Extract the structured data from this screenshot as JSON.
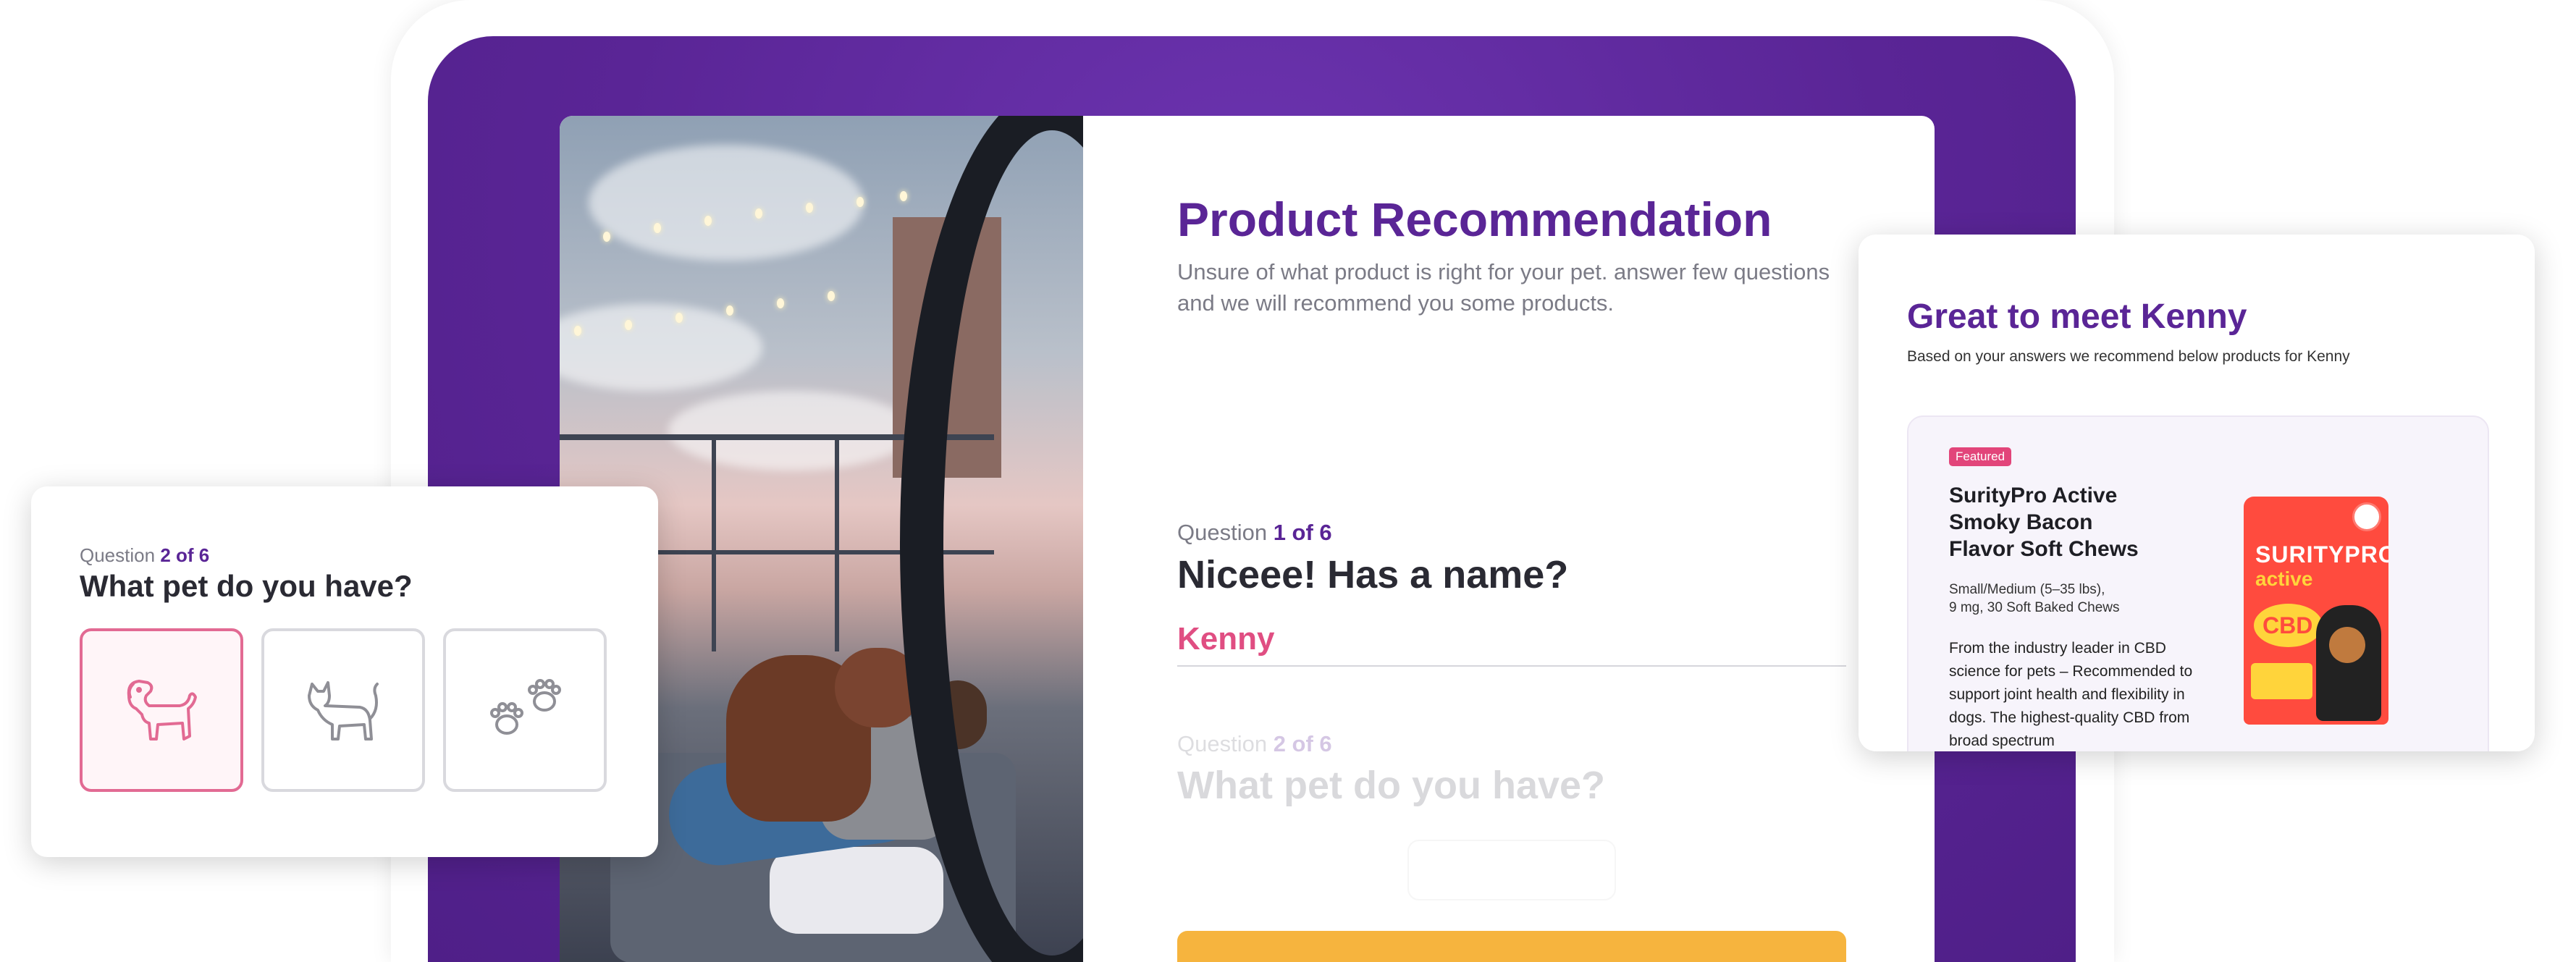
{
  "form": {
    "title": "Product Recommendation",
    "subtitle": "Unsure of what product is right for your pet. answer few questions and we will recommend you some products.",
    "q1": {
      "prefix": "Question",
      "count": "1 of 6",
      "title": "Niceee! Has a name?",
      "value": "Kenny"
    },
    "q2": {
      "prefix": "Question",
      "count": "2 of 6",
      "title": "What pet do you have?"
    }
  },
  "pet_card": {
    "prefix": "Question",
    "count": "2 of 6",
    "title": "What pet do you have?",
    "options": [
      "dog-icon",
      "cat-icon",
      "paws-icon"
    ],
    "selected": "dog",
    "accent": "#e26a93"
  },
  "recommendation": {
    "title": "Great to meet Kenny",
    "subtitle": "Based on your answers we recommend below products for Kenny",
    "product": {
      "badge": "Featured",
      "name_lines": [
        "SurityPro Active",
        "Smoky Bacon",
        "Flavor Soft Chews"
      ],
      "meta_lines": [
        "Small/Medium (5–35 lbs),",
        "9 mg, 30 Soft Baked Chews"
      ],
      "description": "From the industry leader in CBD science for pets – Recommended to support joint health and flexibility in dogs. The highest-quality CBD from broad spectrum",
      "pack_brand": "SURITYPRO",
      "pack_sub": "active",
      "pack_cbd": "CBD"
    }
  },
  "colors": {
    "brand_purple": "#5a2596",
    "accent_pink": "#e04e82",
    "cta_yellow": "#f6b43e"
  }
}
